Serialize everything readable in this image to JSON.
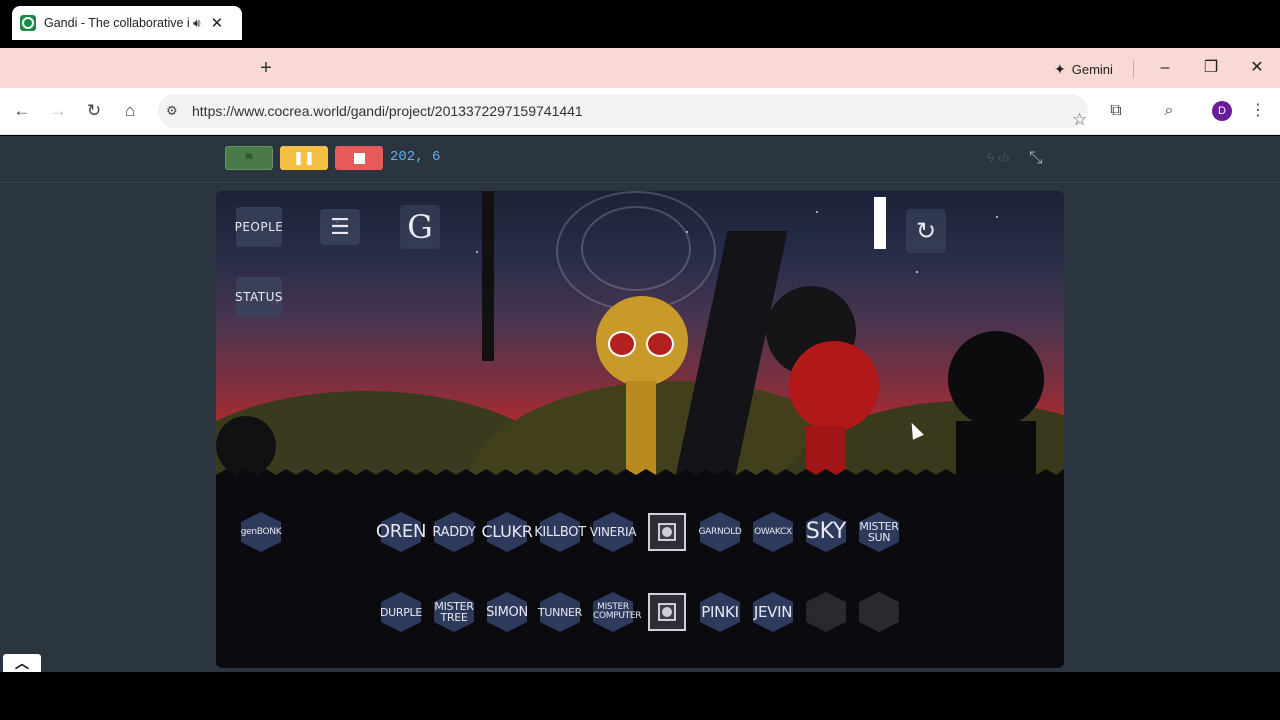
{
  "browser": {
    "tab": {
      "title": "Gandi - The collaborative in",
      "close_icon": "close-icon",
      "speaker_icon": "speaker-icon"
    },
    "new_tab_label": "+",
    "gemini_label": "Gemini",
    "window_controls": {
      "minimize": "–",
      "restore": "❐",
      "close": "✕"
    },
    "address": {
      "url": "https://www.cocrea.world/gandi/project/2013372297159741441"
    },
    "profile_initial": "D"
  },
  "player": {
    "coordinates": "202, 6",
    "colors": {
      "flag": "#4a7a4a",
      "pause": "#f4c043",
      "stop": "#e85a5a",
      "coords": "#5fb0e8"
    }
  },
  "stage": {
    "hud": {
      "people_label": "PEOPLE",
      "status_label": "STATUS",
      "menu_icon": "☰",
      "logo_letter": "G",
      "restart_icon": "restart-icon"
    },
    "bonus_button_label": "genBONK",
    "row1": [
      "OREN",
      "RADDY",
      "CLUKR",
      "KILLBOT",
      "VINERIA",
      "",
      "GARNOLD",
      "OWAKCX",
      "SKY",
      "MISTER SUN"
    ],
    "row2": [
      "DURPLE",
      "MISTER TREE",
      "SIMON",
      "TUNNER",
      "MISTER COMPUTER",
      "",
      "PINKI",
      "JEVIN",
      "",
      ""
    ]
  }
}
